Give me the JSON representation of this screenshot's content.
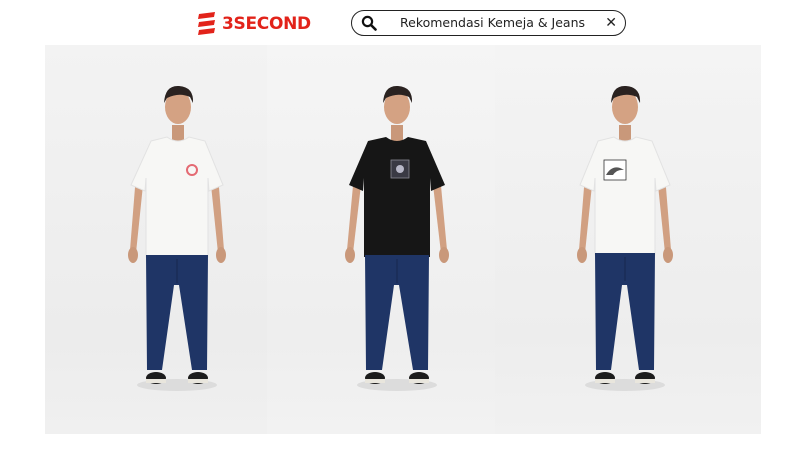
{
  "brand": {
    "name": "3SECOND",
    "color": "#e2231a",
    "icon": "brand-stripes-icon"
  },
  "search": {
    "query": "Rekomendasi Kemeja & Jeans",
    "icon": "search-icon",
    "clear_icon": "close-icon"
  },
  "gallery": {
    "items": [
      {
        "subject": "model-white-tshirt-jeans",
        "shirt_color": "#f7f7f5",
        "print": "red-circle-logo"
      },
      {
        "subject": "model-black-tshirt-jeans",
        "shirt_color": "#161616",
        "print": "square-graphic"
      },
      {
        "subject": "model-white-tshirt-jeans",
        "shirt_color": "#f7f7f5",
        "print": "wave-sketch"
      }
    ],
    "jeans_color": "#1f3566"
  }
}
